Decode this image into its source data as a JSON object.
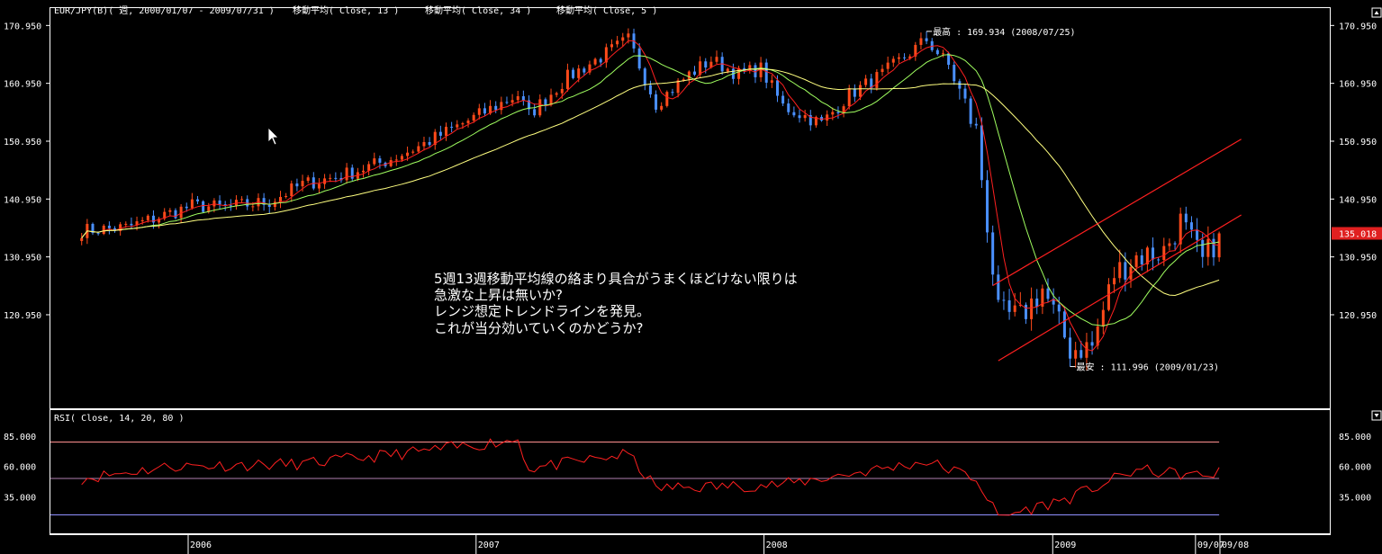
{
  "header": {
    "symbol": "EUR/JPY(B)( 週, 2000/01/07 - 2009/07/31 )",
    "ma_labels": [
      "移動平均( Close, 13 )",
      "移動平均( Close, 34 )",
      "移動平均( Close, 5 )"
    ]
  },
  "rsi_header": "RSI( Close, 14, 20, 80 )",
  "annotation_lines": [
    "5週13週移動平均線の絡まり具合がうまくほどけない限りは",
    "急激な上昇は無いか?",
    "レンジ想定トレンドラインを発見。",
    "これが当分効いていくのかどうか?"
  ],
  "high_label": "最高 : 169.934 (2008/07/25)",
  "low_label": "最安 : 111.996 (2009/01/23)",
  "current_price": "135.018",
  "colors": {
    "up": "#ff4a1a",
    "down": "#4a90ff",
    "ma5": "#ff2020",
    "ma13": "#a0ff60",
    "ma34": "#ffff80",
    "rsi": "#ff2020",
    "channel": "#ff2020",
    "rsi_level_high": "#ff9090",
    "rsi_level_mid": "#b080b0",
    "rsi_level_low": "#9090ff"
  },
  "chart_data": [
    {
      "type": "candlestick",
      "title": "EUR/JPY(B)( 週, 2000/01/07 - 2009/07/31 )",
      "series_names": [
        "移動平均( Close, 13 )",
        "移動平均( Close, 34 )",
        "移動平均( Close, 5 )"
      ],
      "y_ticks": [
        "170.950",
        "160.950",
        "150.950",
        "140.950",
        "130.950",
        "120.950"
      ],
      "ylim": [
        108.2,
        172.4
      ],
      "x_ticks": [
        "2006",
        "2007",
        "2008",
        "2009",
        "09/07",
        "09/08"
      ],
      "x_tick_dates": [
        "2006-01-01",
        "2007-01-01",
        "2008-01-01",
        "2009-01-01",
        "2009-07-01",
        "2009-08-01"
      ],
      "start_date": "2005-08-19",
      "high": {
        "date": "2008-07-25",
        "value": 169.934
      },
      "low": {
        "date": "2009-01-23",
        "value": 111.996
      },
      "last_close": 135.018,
      "close_keypoints": [
        [
          "2005-08-19",
          135.5
        ],
        [
          "2005-10-14",
          136.0
        ],
        [
          "2005-12-09",
          138.5
        ],
        [
          "2006-01-06",
          139.8
        ],
        [
          "2006-02-17",
          139.5
        ],
        [
          "2006-04-14",
          140.5
        ],
        [
          "2006-05-26",
          143.5
        ],
        [
          "2006-07-14",
          145.0
        ],
        [
          "2006-09-08",
          147.5
        ],
        [
          "2006-10-20",
          150.0
        ],
        [
          "2006-12-08",
          153.5
        ],
        [
          "2007-01-12",
          156.0
        ],
        [
          "2007-02-23",
          159.0
        ],
        [
          "2007-03-09",
          155.5
        ],
        [
          "2007-04-27",
          162.0
        ],
        [
          "2007-06-08",
          165.5
        ],
        [
          "2007-07-13",
          168.5
        ],
        [
          "2007-08-17",
          157.5
        ],
        [
          "2007-09-28",
          162.5
        ],
        [
          "2007-10-26",
          165.0
        ],
        [
          "2007-11-30",
          162.5
        ],
        [
          "2007-12-28",
          163.5
        ],
        [
          "2008-01-25",
          157.0
        ],
        [
          "2008-03-14",
          154.0
        ],
        [
          "2008-04-18",
          159.0
        ],
        [
          "2008-05-30",
          162.5
        ],
        [
          "2008-07-25",
          168.5
        ],
        [
          "2008-08-22",
          164.0
        ],
        [
          "2008-09-26",
          152.5
        ],
        [
          "2008-10-24",
          121.0
        ],
        [
          "2008-11-21",
          120.5
        ],
        [
          "2008-12-19",
          125.5
        ],
        [
          "2009-01-23",
          115.0
        ],
        [
          "2009-02-20",
          115.5
        ],
        [
          "2009-03-20",
          128.0
        ],
        [
          "2009-04-17",
          131.0
        ],
        [
          "2009-05-22",
          132.0
        ],
        [
          "2009-06-12",
          137.0
        ],
        [
          "2009-07-10",
          130.0
        ],
        [
          "2009-07-31",
          135.018
        ]
      ],
      "trend_lines": [
        {
          "from": [
            "2008-10-17",
            126.0
          ],
          "to": [
            "2009-08-28",
            151.3
          ]
        },
        {
          "from": [
            "2008-10-24",
            113.0
          ],
          "to": [
            "2009-08-28",
            138.2
          ]
        }
      ]
    },
    {
      "type": "line",
      "title": "RSI( Close, 14, 20, 80 )",
      "y_ticks": [
        "85.000",
        "60.000",
        "35.000"
      ],
      "ylim": [
        10.0,
        93.0
      ],
      "levels": [
        80,
        50,
        20
      ],
      "keypoints": [
        [
          "2005-08-19",
          50
        ],
        [
          "2005-12-09",
          60
        ],
        [
          "2006-05-26",
          62
        ],
        [
          "2006-10-20",
          72
        ],
        [
          "2007-02-23",
          82
        ],
        [
          "2007-03-09",
          58
        ],
        [
          "2007-07-13",
          70
        ],
        [
          "2007-08-17",
          42
        ],
        [
          "2008-01-25",
          45
        ],
        [
          "2008-07-25",
          64
        ],
        [
          "2008-09-26",
          50
        ],
        [
          "2008-10-24",
          18
        ],
        [
          "2009-01-23",
          34
        ],
        [
          "2009-04-17",
          57
        ],
        [
          "2009-07-10",
          52
        ],
        [
          "2009-07-31",
          55
        ]
      ]
    }
  ]
}
